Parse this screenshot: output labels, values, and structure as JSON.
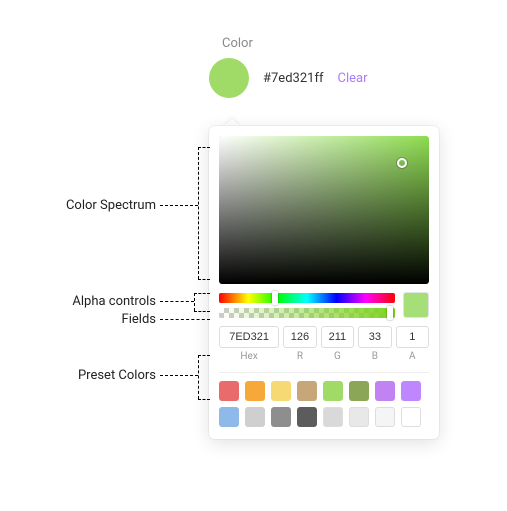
{
  "header": {
    "label": "Color",
    "hex_display": "#7ed321ff",
    "clear": "Clear",
    "swatch_color": "#9fdb66"
  },
  "annotations": {
    "spectrum": "Color Spectrum",
    "alpha": "Alpha controls",
    "fields": "Fields",
    "presets": "Preset Colors"
  },
  "spectrum": {
    "base_color": "#8edc50"
  },
  "fields": {
    "hex": {
      "value": "7ED321",
      "label": "Hex"
    },
    "r": {
      "value": "126",
      "label": "R"
    },
    "g": {
      "value": "211",
      "label": "G"
    },
    "b": {
      "value": "33",
      "label": "B"
    },
    "a": {
      "value": "1",
      "label": "A"
    }
  },
  "presets": [
    "#e96b6b",
    "#f6a93b",
    "#f7d974",
    "#c7a77a",
    "#9fdb66",
    "#8aa656",
    "#c183f2",
    "#bf87ff",
    "#8fb9e8",
    "#cfcfcf",
    "#8e8e8e",
    "#5c5c5c",
    "#d9d9d9",
    "#e8e8e8",
    "#f5f5f5",
    "#ffffff"
  ]
}
